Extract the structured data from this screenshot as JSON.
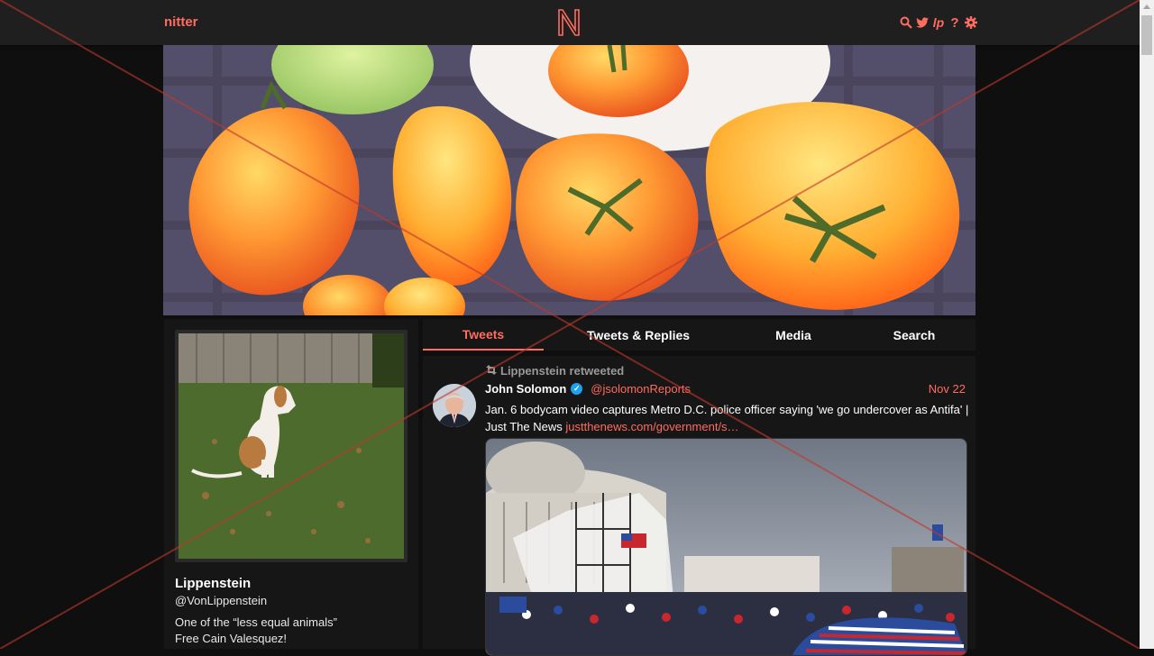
{
  "nav": {
    "brand": "nitter",
    "logo_letter": "N",
    "icons": [
      "search-icon",
      "twitter-icon",
      "liberapay-icon",
      "help-icon",
      "gear-icon"
    ]
  },
  "profile": {
    "fullname": "Lippenstein",
    "username": "@VonLippenstein",
    "bio_line1": "One of the “less equal animals”",
    "bio_line2": "Free Cain Valesquez!"
  },
  "tabs": [
    {
      "label": "Tweets",
      "active": true
    },
    {
      "label": "Tweets & Replies",
      "active": false
    },
    {
      "label": "Media",
      "active": false
    },
    {
      "label": "Search",
      "active": false
    }
  ],
  "tweet": {
    "retweet_text": "Lippenstein retweeted",
    "name": "John Solomon",
    "handle": "@jsolomonReports",
    "date": "Nov 22",
    "text": "Jan. 6 bodycam video captures Metro D.C. police officer saying 'we go undercover as Antifa'   | Just The News ",
    "link": "justthenews.com/government/s…"
  },
  "colors": {
    "accent": "#ff6c60",
    "background": "#0f0f0f",
    "panel": "#161616",
    "nav": "#1f1f1f"
  }
}
